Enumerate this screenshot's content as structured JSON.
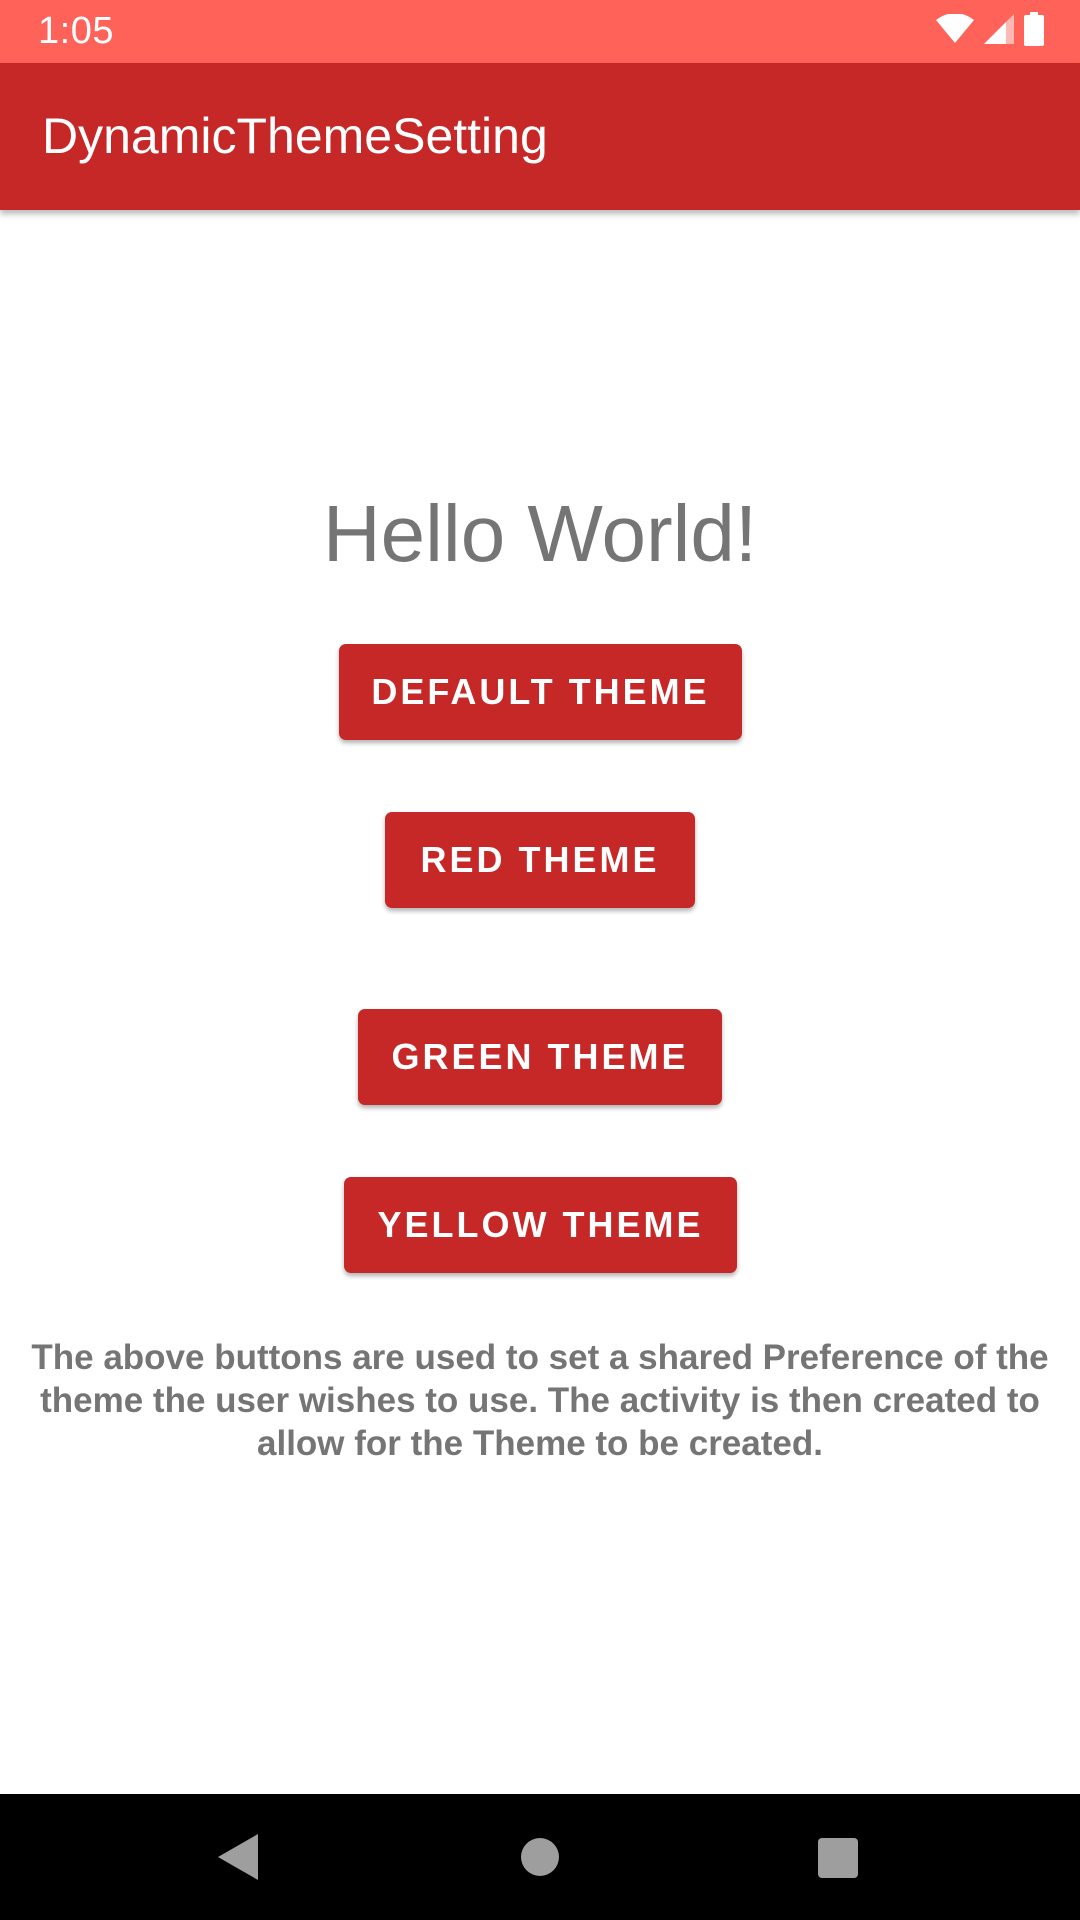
{
  "status_bar": {
    "time": "1:05",
    "background": "#FF6259",
    "icons": [
      "wifi-icon",
      "cellular-signal-icon",
      "battery-icon"
    ]
  },
  "app_bar": {
    "title": "DynamicThemeSetting",
    "background": "#C62828"
  },
  "main": {
    "greeting": "Hello World!",
    "buttons": [
      {
        "label": "DEFAULT THEME"
      },
      {
        "label": "RED THEME"
      },
      {
        "label": "GREEN THEME"
      },
      {
        "label": "YELLOW THEME"
      }
    ],
    "button_color": "#C62828",
    "description": "The above buttons are used to set a shared Preference of the theme the user wishes to use. The activity is then created to allow for the Theme to be created."
  },
  "nav_bar": {
    "icons": [
      "back-icon",
      "home-icon",
      "recents-icon"
    ]
  }
}
